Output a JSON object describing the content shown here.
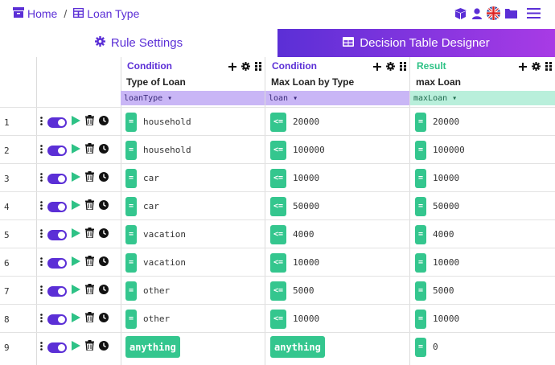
{
  "breadcrumb": {
    "home": "Home",
    "separator": "/",
    "current": "Loan Type"
  },
  "top_icons": [
    "package-icon",
    "user-icon",
    "uk-flag-icon",
    "folder-icon",
    "menu-icon"
  ],
  "tabs": [
    {
      "label": "Rule Settings",
      "icon": "gear-icon",
      "active": false
    },
    {
      "label": "Decision Table Designer",
      "icon": "table-icon",
      "active": true
    }
  ],
  "columns": [
    {
      "kind": "Condition",
      "name": "Type of Loan",
      "variable": "loanType"
    },
    {
      "kind": "Condition",
      "name": "Max Loan by Type",
      "variable": "loan"
    },
    {
      "kind": "Result",
      "name": "max Loan",
      "variable": "maxLoan"
    }
  ],
  "rows": [
    {
      "num": "1",
      "c1_op": "=",
      "c1": "household",
      "c2_op": "<=",
      "c2": "20000",
      "r_op": "=",
      "r": "20000"
    },
    {
      "num": "2",
      "c1_op": "=",
      "c1": "household",
      "c2_op": "<=",
      "c2": "100000",
      "r_op": "=",
      "r": "100000"
    },
    {
      "num": "3",
      "c1_op": "=",
      "c1": "car",
      "c2_op": "<=",
      "c2": "10000",
      "r_op": "=",
      "r": "10000"
    },
    {
      "num": "4",
      "c1_op": "=",
      "c1": "car",
      "c2_op": "<=",
      "c2": "50000",
      "r_op": "=",
      "r": "50000"
    },
    {
      "num": "5",
      "c1_op": "=",
      "c1": "vacation",
      "c2_op": "<=",
      "c2": "4000",
      "r_op": "=",
      "r": "4000"
    },
    {
      "num": "6",
      "c1_op": "=",
      "c1": "vacation",
      "c2_op": "<=",
      "c2": "10000",
      "r_op": "=",
      "r": "10000"
    },
    {
      "num": "7",
      "c1_op": "=",
      "c1": "other",
      "c2_op": "<=",
      "c2": "5000",
      "r_op": "=",
      "r": "5000"
    },
    {
      "num": "8",
      "c1_op": "=",
      "c1": "other",
      "c2_op": "<=",
      "c2": "10000",
      "r_op": "=",
      "r": "10000"
    },
    {
      "num": "9",
      "c1_any": "anything",
      "c2_any": "anything",
      "r_op": "=",
      "r": "0"
    }
  ],
  "colors": {
    "accent": "#5b2fd6",
    "condition_bg": "#c9b6f6",
    "result": "#2ec286",
    "result_bg": "#b9efdb",
    "chip": "#34c68e"
  }
}
